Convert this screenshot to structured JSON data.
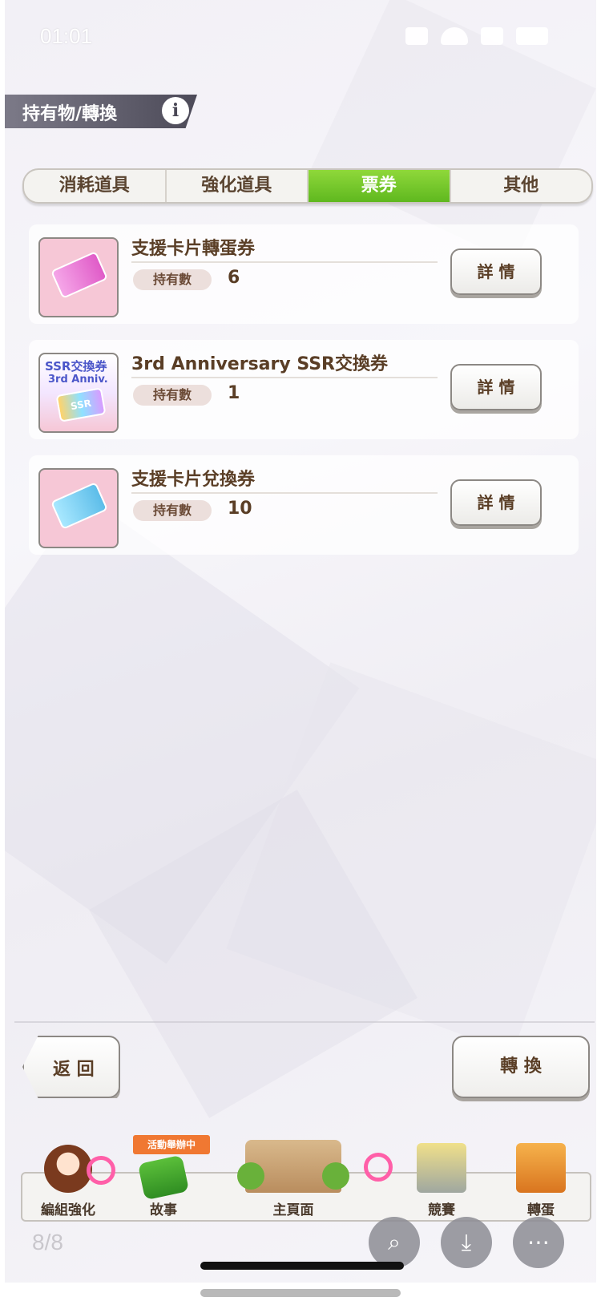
{
  "status_bar": {
    "time": "01:01"
  },
  "header": {
    "title": "持有物/轉換",
    "info_glyph": "i"
  },
  "tabs": [
    {
      "label": "消耗道具",
      "active": false
    },
    {
      "label": "強化道具",
      "active": false
    },
    {
      "label": "票券",
      "active": true
    },
    {
      "label": "其他",
      "active": false
    }
  ],
  "items": [
    {
      "name": "支援卡片轉蛋券",
      "owned_label": "持有數",
      "owned_count": "6",
      "detail_label": "詳 情",
      "icon": "pink-ticket-icon"
    },
    {
      "name": "3rd Anniversary SSR交換券",
      "owned_label": "持有數",
      "owned_count": "1",
      "detail_label": "詳 情",
      "icon": "ssr-exchange-ticket-icon",
      "icon_text": {
        "line1": "SSR交換券",
        "line2": "3rd Anniv.",
        "badge": "SSR"
      }
    },
    {
      "name": "支援卡片兌換券",
      "owned_label": "持有數",
      "owned_count": "10",
      "detail_label": "詳 情",
      "icon": "blue-ticket-icon"
    }
  ],
  "buttons": {
    "back_label": "返 回",
    "convert_label": "轉 換"
  },
  "nav": {
    "event_badge": "活動舉辦中",
    "items": [
      {
        "label": "編組強化",
        "icon": "character-icon"
      },
      {
        "label": "故事",
        "icon": "story-book-icon"
      },
      {
        "label": "主頁面",
        "icon": "school-building-icon"
      },
      {
        "label": "競賽",
        "icon": "race-gate-icon"
      },
      {
        "label": "轉蛋",
        "icon": "gacha-door-icon"
      }
    ]
  },
  "overlay": {
    "page_indicator": "8/8"
  },
  "colors": {
    "active_tab": "#6cc428",
    "text_brown": "#5a3e26",
    "header_bg": "#5a5866",
    "event_badge": "#f07832",
    "pink_accent": "#ff5fa8"
  }
}
